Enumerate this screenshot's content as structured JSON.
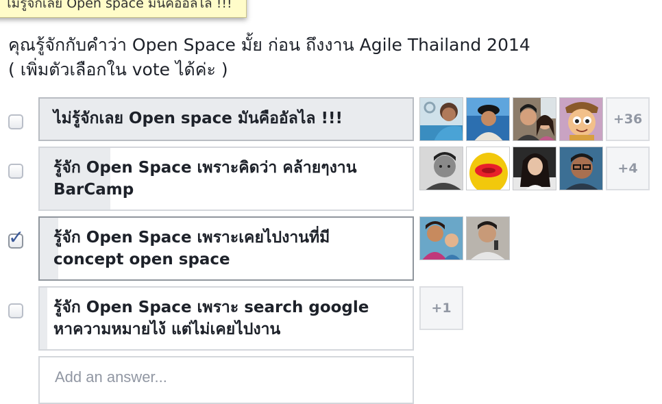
{
  "tooltip": "ไม่รู้จักเลย Open space มันคืออัลไล !!!",
  "question": {
    "line1": "คุณรู้จักกับคำว่า Open Space มั้ย ก่อน ถึงงาน Agile Thailand 2014",
    "line2": "( เพิ่มตัวเลือกใน vote ได้ค่ะ )"
  },
  "options": [
    {
      "label": "ไม่รู้จักเลย Open space มันคืออัลไล !!!",
      "checked": false,
      "vote_fraction": 1.0,
      "avatars": [
        "avatar-man-blue-shirt",
        "avatar-man-black-hat",
        "avatar-couple-selfie",
        "avatar-cartoon-boy"
      ],
      "more": "+36"
    },
    {
      "label": "รู้จัก Open Space เพราะคิดว่า คล้ายๆงาน BarCamp",
      "checked": false,
      "vote_fraction": 0.19,
      "avatars": [
        "avatar-man-bw",
        "avatar-yellow-blob",
        "avatar-woman-long-hair",
        "avatar-man-glasses"
      ],
      "more": "+4"
    },
    {
      "label": "รู้จัก Open Space เพราะเคยไปงานที่มี concept open space",
      "checked": true,
      "vote_fraction": 0.05,
      "avatars": [
        "avatar-woman-with-child",
        "avatar-man-holding-mic"
      ],
      "more": ""
    },
    {
      "label": "รู้จัก Open Space เพราะ search google หาความหมายไง้ แต่ไม่เคยไปงาน",
      "checked": false,
      "vote_fraction": 0.02,
      "avatars": [],
      "more": "+1"
    }
  ],
  "add_answer_placeholder": "Add an answer..."
}
